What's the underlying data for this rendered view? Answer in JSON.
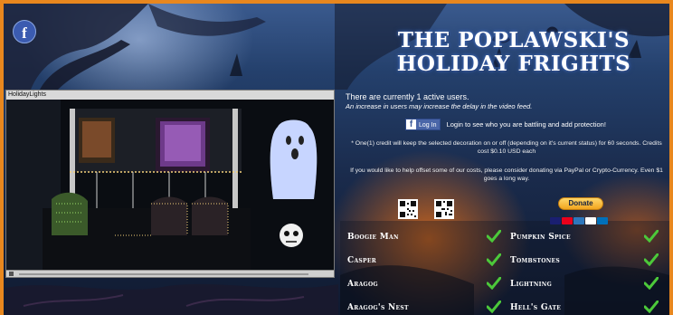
{
  "page": {
    "facebook_icon_glyph": "f",
    "headline_line1": "THE POPLAWSKI'S",
    "headline_line2": "HOLIDAY FRIGHTS"
  },
  "video": {
    "title": "HolidayLights"
  },
  "info": {
    "active_users": "There are currently 1 active users.",
    "delay_note": "An increase in users may increase the delay in the video feed.",
    "login_button": "Log In",
    "login_prompt": "Login to see who you are battling and add protection!",
    "credit_note": "* One(1) credit will keep the selected decoration on or off (depending on it's current status) for 60 seconds. Credits cost $0.10 USD each",
    "donate_note": "If you would like to help offset some of our costs, please consider donating via PayPal or Crypto-Currency. Even $1 goes a long way.",
    "donate_button": "Donate"
  },
  "decorations": [
    {
      "left": "Boogie Man",
      "right": "Pumpkin Spice"
    },
    {
      "left": "Casper",
      "right": "Tombstones"
    },
    {
      "left": "Aragog",
      "right": "Lightning"
    },
    {
      "left": "Aragog's Nest",
      "right": "Hell's Gate"
    }
  ],
  "colors": {
    "border": "#e8871e",
    "check": "#4cc93a",
    "facebook": "#3b5998"
  },
  "icons": {
    "facebook": "facebook-icon",
    "check": "check-icon",
    "qr": "qr-code-icon"
  }
}
